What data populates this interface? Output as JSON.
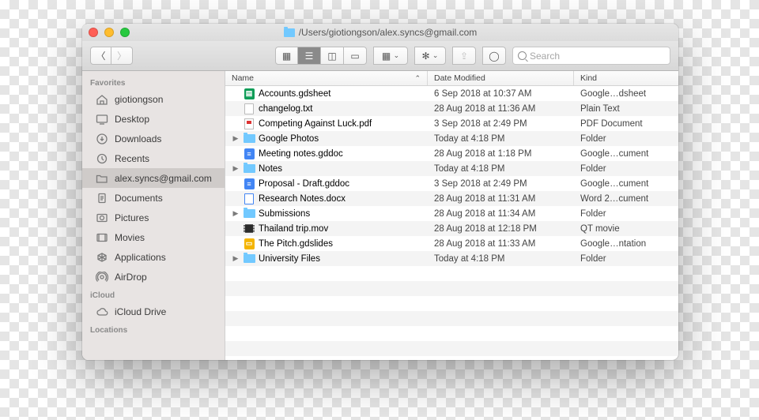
{
  "title": "/Users/giotiongson/alex.syncs@gmail.com",
  "search_placeholder": "Search",
  "sidebar": {
    "sections": [
      {
        "label": "Favorites",
        "items": [
          {
            "icon": "home",
            "label": "giotiongson",
            "sel": false
          },
          {
            "icon": "desktop",
            "label": "Desktop",
            "sel": false
          },
          {
            "icon": "downloads",
            "label": "Downloads",
            "sel": false
          },
          {
            "icon": "recents",
            "label": "Recents",
            "sel": false
          },
          {
            "icon": "folder",
            "label": "alex.syncs@gmail.com",
            "sel": true
          },
          {
            "icon": "documents",
            "label": "Documents",
            "sel": false
          },
          {
            "icon": "pictures",
            "label": "Pictures",
            "sel": false
          },
          {
            "icon": "movies",
            "label": "Movies",
            "sel": false
          },
          {
            "icon": "applications",
            "label": "Applications",
            "sel": false
          },
          {
            "icon": "airdrop",
            "label": "AirDrop",
            "sel": false
          }
        ]
      },
      {
        "label": "iCloud",
        "items": [
          {
            "icon": "cloud",
            "label": "iCloud Drive",
            "sel": false
          }
        ]
      },
      {
        "label": "Locations",
        "items": []
      }
    ]
  },
  "columns": {
    "name": "Name",
    "date": "Date Modified",
    "kind": "Kind"
  },
  "files": [
    {
      "exp": false,
      "expandable": false,
      "icon": "gsheet",
      "name": "Accounts.gdsheet",
      "date": "6 Sep 2018 at 10:37 AM",
      "kind": "Google…dsheet"
    },
    {
      "exp": false,
      "expandable": false,
      "icon": "txt",
      "name": "changelog.txt",
      "date": "28 Aug 2018 at 11:36 AM",
      "kind": "Plain Text"
    },
    {
      "exp": false,
      "expandable": false,
      "icon": "pdf",
      "name": "Competing Against Luck.pdf",
      "date": "3 Sep 2018 at 2:49 PM",
      "kind": "PDF Document"
    },
    {
      "exp": false,
      "expandable": true,
      "icon": "folder",
      "name": "Google Photos",
      "date": "Today at 4:18 PM",
      "kind": "Folder"
    },
    {
      "exp": false,
      "expandable": false,
      "icon": "gdoc",
      "name": "Meeting notes.gddoc",
      "date": "28 Aug 2018 at 1:18 PM",
      "kind": "Google…cument"
    },
    {
      "exp": false,
      "expandable": true,
      "icon": "folder",
      "name": "Notes",
      "date": "Today at 4:18 PM",
      "kind": "Folder"
    },
    {
      "exp": false,
      "expandable": false,
      "icon": "gdoc",
      "name": "Proposal - Draft.gddoc",
      "date": "3 Sep 2018 at 2:49 PM",
      "kind": "Google…cument"
    },
    {
      "exp": false,
      "expandable": false,
      "icon": "docx",
      "name": "Research Notes.docx",
      "date": "28 Aug 2018 at 11:31 AM",
      "kind": "Word 2…cument"
    },
    {
      "exp": false,
      "expandable": true,
      "icon": "folder",
      "name": "Submissions",
      "date": "28 Aug 2018 at 11:34 AM",
      "kind": "Folder"
    },
    {
      "exp": false,
      "expandable": false,
      "icon": "mov",
      "name": "Thailand trip.mov",
      "date": "28 Aug 2018 at 12:18 PM",
      "kind": "QT movie"
    },
    {
      "exp": false,
      "expandable": false,
      "icon": "gslides",
      "name": "The Pitch.gdslides",
      "date": "28 Aug 2018 at 11:33 AM",
      "kind": "Google…ntation"
    },
    {
      "exp": false,
      "expandable": true,
      "icon": "folder",
      "name": "University Files",
      "date": "Today at 4:18 PM",
      "kind": "Folder"
    }
  ]
}
